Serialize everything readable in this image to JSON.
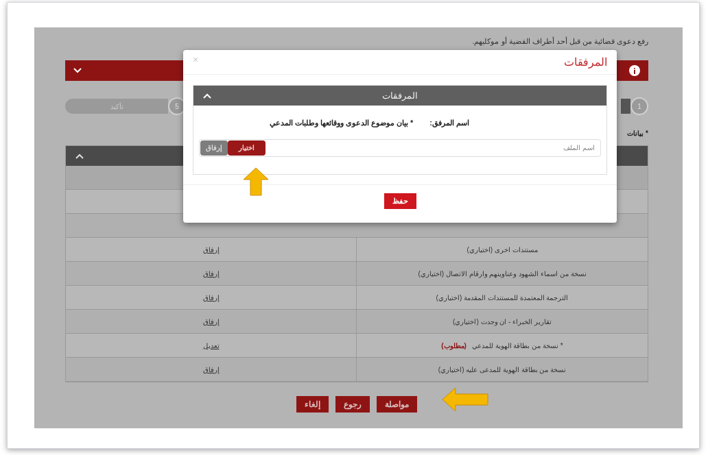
{
  "page": {
    "intro": "رفع دعوى قضائية من قبل أحد أطراف القضية أو موكليهم.",
    "steps": [
      {
        "number": "1"
      },
      {
        "number": "5",
        "label": "تأكيد"
      }
    ],
    "required_note": "* بيانات"
  },
  "table": {
    "rows": [
      {
        "document": "مستندات اخرى (اختياري)",
        "action": "إرفاق"
      },
      {
        "document": "نسخة من اسماء الشهود وعناوينهم وارقام الاتصال (اختياري)",
        "action": "إرفاق"
      },
      {
        "document": "الترجمة المعتمدة للمستندات المقدمة (اختياري)",
        "action": "إرفاق"
      },
      {
        "document": "تقارير الخبراء - ان وجدت (اختياري)",
        "action": "إرفاق"
      },
      {
        "document": "* نسخة من بطاقة الهوية للمدعي",
        "required_tag": "(مطلوب)",
        "action": "تعديل"
      },
      {
        "document": "نسخة من بطاقة الهوية للمدعى عليه (اختياري)",
        "action": "إرفاق"
      }
    ]
  },
  "buttons": [
    {
      "label": "مواصلة"
    },
    {
      "label": "رجوع"
    },
    {
      "label": "إلغاء"
    }
  ],
  "dialog": {
    "title": "المرفقات",
    "close": "×",
    "panel_title": "المرفقات",
    "field_label": "اسم المرفق:",
    "field_value": "* بيان موضوع الدعوى ووقائعها وطلبات المدعي",
    "file_placeholder": "اسم الملف",
    "choose_button": "اختيار",
    "attach_button": "إرفاق",
    "save_button": "حفظ"
  }
}
